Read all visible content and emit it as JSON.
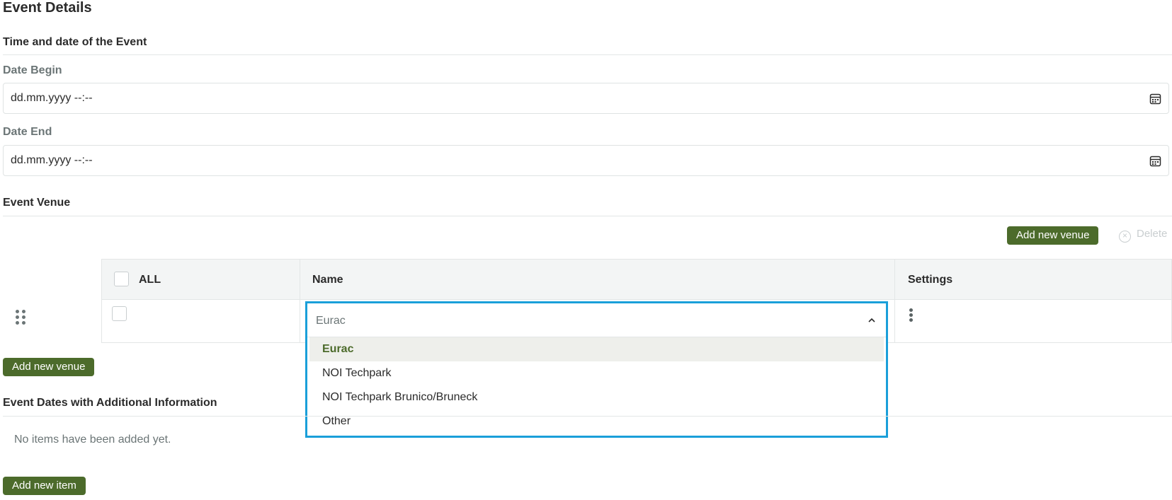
{
  "page_title": "Event Details",
  "time_section": {
    "title": "Time and date of the Event",
    "date_begin": {
      "label": "Date Begin",
      "value": "dd.mm.yyyy --:--"
    },
    "date_end": {
      "label": "Date End",
      "value": "dd.mm.yyyy --:--"
    }
  },
  "venue_section": {
    "title": "Event Venue",
    "add_venue_label": "Add new venue",
    "delete_label": "Delete",
    "table": {
      "headers": {
        "all": "ALL",
        "name": "Name",
        "settings": "Settings"
      }
    },
    "dropdown": {
      "selected": "Eurac",
      "options": [
        "Eurac",
        "NOI Techpark",
        "NOI Techpark Brunico/Bruneck",
        "Other"
      ]
    },
    "add_venue_bottom_label": "Add new venue"
  },
  "additional_section": {
    "title": "Event Dates with Additional Information",
    "empty_text": "No items have been added yet.",
    "add_item_label": "Add new item"
  },
  "colors": {
    "accent_green": "#4c6b2b",
    "focus_blue": "#1a9fd9"
  }
}
